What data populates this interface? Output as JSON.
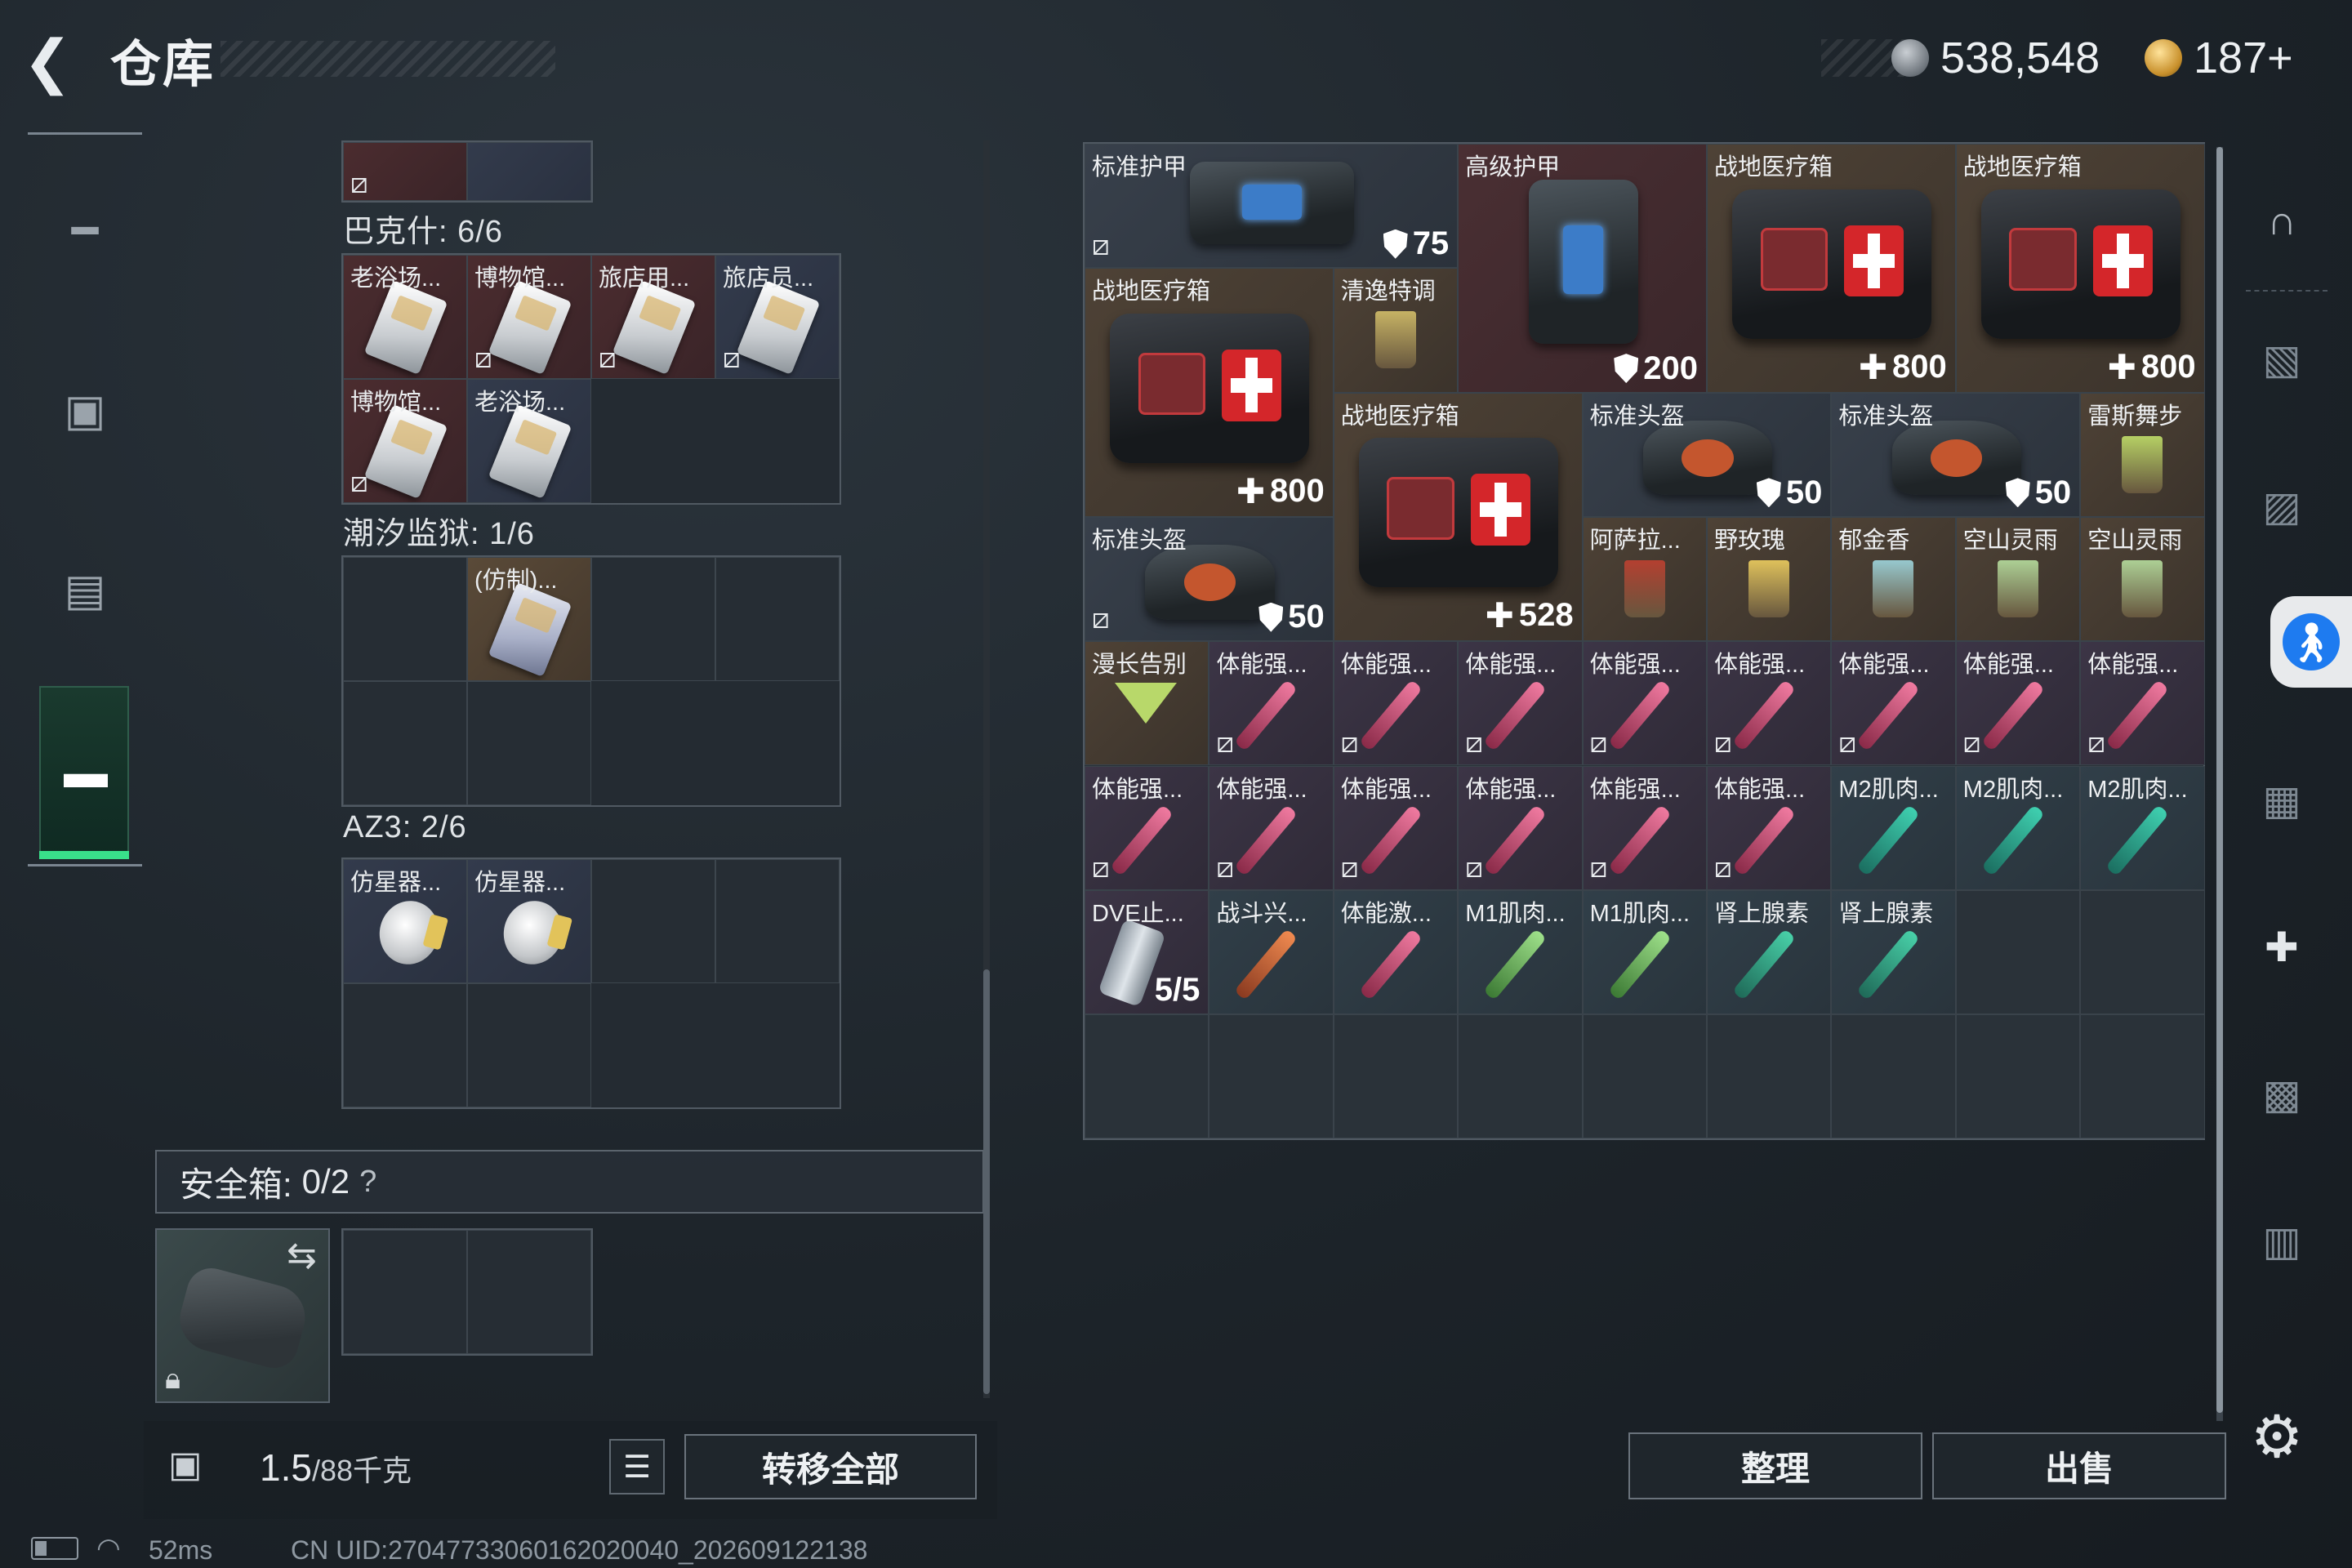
{
  "topbar": {
    "title": "仓库",
    "back_icon": "back-arrow-icon",
    "currency_silver": "538,548",
    "currency_gold": "187+"
  },
  "leftnav": {
    "items": [
      {
        "name": "weapon",
        "icon": "gun-icon"
      },
      {
        "name": "backpack",
        "icon": "backpack-icon"
      },
      {
        "name": "vest",
        "icon": "vest-icon"
      },
      {
        "name": "toolbox",
        "icon": "toolbox-icon",
        "active": true
      }
    ]
  },
  "backpack": {
    "sections": [
      {
        "label": "巴克什: 6/6"
      },
      {
        "label": "潮汐监狱: 1/6"
      },
      {
        "label": "AZ3: 2/6"
      }
    ],
    "bakshi_items": [
      "老浴场...",
      "博物馆...",
      "旅店用...",
      "旅店员...",
      "博物馆...",
      "老浴场..."
    ],
    "prison_items": [
      "(仿制)..."
    ],
    "az3_items": [
      "仿星器...",
      "仿星器..."
    ],
    "safe_box_label": "安全箱:",
    "safe_box_count": "0/2",
    "safe_box_help": "?",
    "weight_value": "1.5",
    "weight_max": "/88千克",
    "transfer_all": "转移全部"
  },
  "warehouse": {
    "items": [
      {
        "name": "标准护甲",
        "value": "75"
      },
      {
        "name": "高级护甲",
        "value": "200"
      },
      {
        "name": "战地医疗箱",
        "value": "800"
      },
      {
        "name": "战地医疗箱",
        "value": "800"
      },
      {
        "name": "战地医疗箱",
        "value": "800"
      },
      {
        "name": "清逸特调"
      },
      {
        "name": "战地医疗箱",
        "value": "528"
      },
      {
        "name": "标准头盔",
        "value": "50"
      },
      {
        "name": "标准头盔",
        "value": "50"
      },
      {
        "name": "雷斯舞步"
      },
      {
        "name": "标准头盔",
        "value": "50"
      },
      {
        "name": "阿萨拉..."
      },
      {
        "name": "野玫瑰"
      },
      {
        "name": "郁金香"
      },
      {
        "name": "空山灵雨"
      },
      {
        "name": "空山灵雨"
      },
      {
        "name": "漫长告别"
      },
      {
        "name": "体能强..."
      },
      {
        "name": "M2肌肉..."
      },
      {
        "name": "DVE止...",
        "value": "5/5"
      },
      {
        "name": "战斗兴..."
      },
      {
        "name": "体能激..."
      },
      {
        "name": "M1肌肉..."
      },
      {
        "name": "肾上腺素"
      }
    ],
    "row4_names": [
      "漫长告别",
      "体能强...",
      "体能强...",
      "体能强...",
      "体能强...",
      "体能强...",
      "体能强...",
      "体能强...",
      "体能强..."
    ],
    "row5_names": [
      "体能强...",
      "体能强...",
      "体能强...",
      "体能强...",
      "体能强...",
      "体能强...",
      "M2肌肉...",
      "M2肌肉...",
      "M2肌肉..."
    ],
    "row6_names": [
      "DVE止...",
      "战斗兴...",
      "体能激...",
      "M1肌肉...",
      "M1肌肉...",
      "肾上腺素",
      "肾上腺素"
    ],
    "sort_label": "整理",
    "sell_label": "出售"
  },
  "rightbar": {
    "icons": [
      "helmet-icon",
      "armor-tier-icon",
      "weapon-case-icon",
      "medical-case-icon",
      "ammo-case-icon",
      "key-case-icon",
      "misc-case-icon"
    ],
    "accessibility_icon": "accessibility-icon",
    "settings_icon": "gear-icon"
  },
  "statusbar": {
    "ping": "52ms",
    "uid": "CN UID:270477330601620200​40_202609122138"
  },
  "colors": {
    "accent_green": "#39e08a",
    "access_blue": "#1e7bf0"
  }
}
